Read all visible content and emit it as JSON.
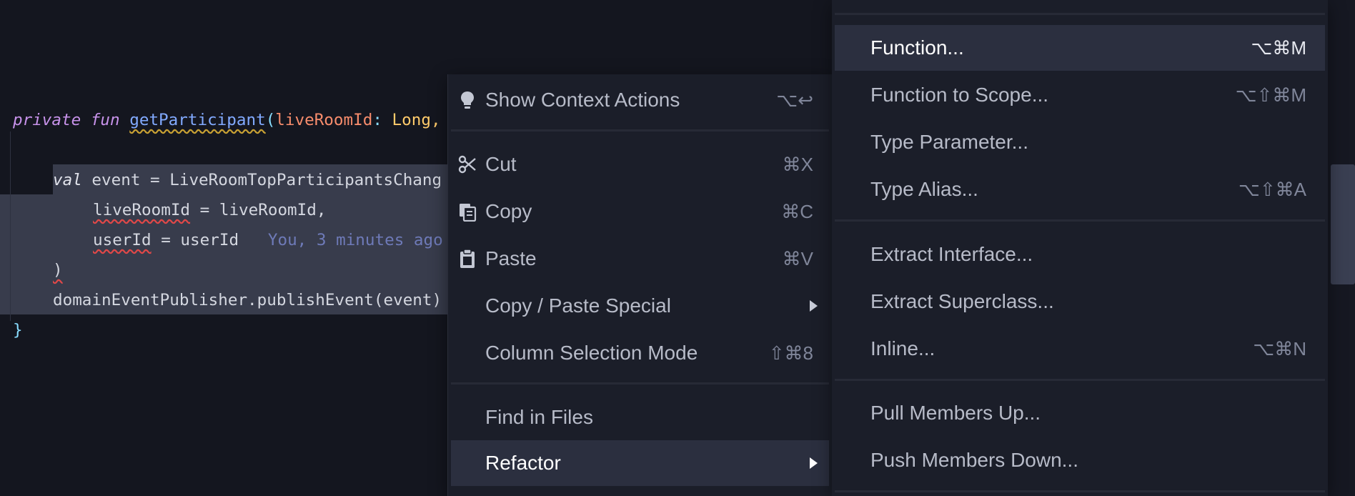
{
  "editor": {
    "line1": {
      "kw_private": "private",
      "kw_fun": "fun",
      "fn_name": "getParticipant",
      "open_paren": "(",
      "param": "liveRoomId",
      "colon": ":",
      "type": "Long,"
    },
    "line3": {
      "kw_val": "val",
      "rest": " event = LiveRoomTopParticipantsChang"
    },
    "line4": {
      "arg": "liveRoomId",
      "rest": " = liveRoomId,"
    },
    "line5": {
      "arg": "userId",
      "rest": " = userId",
      "blame": "You, 3 minutes ago"
    },
    "line6": {
      "text": ")"
    },
    "line7": {
      "text": "domainEventPublisher.publishEvent(event)"
    },
    "line8": {
      "text": "}"
    }
  },
  "context_menu": {
    "items": [
      {
        "label": "Show Context Actions",
        "shortcut": "⌥↩",
        "icon": "lightbulb-icon"
      },
      {
        "label": "Cut",
        "shortcut": "⌘X",
        "icon": "scissors-icon"
      },
      {
        "label": "Copy",
        "shortcut": "⌘C",
        "icon": "copy-icon"
      },
      {
        "label": "Paste",
        "shortcut": "⌘V",
        "icon": "clipboard-icon"
      },
      {
        "label": "Copy / Paste Special",
        "shortcut": ""
      },
      {
        "label": "Column Selection Mode",
        "shortcut": "⇧⌘8"
      },
      {
        "label": "Find in Files",
        "shortcut": ""
      },
      {
        "label": "Refactor",
        "shortcut": ""
      }
    ]
  },
  "refactor_submenu": {
    "items": [
      {
        "label": "Function...",
        "shortcut": "⌥⌘M"
      },
      {
        "label": "Function to Scope...",
        "shortcut": "⌥⇧⌘M"
      },
      {
        "label": "Type Parameter...",
        "shortcut": ""
      },
      {
        "label": "Type Alias...",
        "shortcut": "⌥⇧⌘A"
      },
      {
        "label": "Extract Interface...",
        "shortcut": ""
      },
      {
        "label": "Extract Superclass...",
        "shortcut": ""
      },
      {
        "label": "Inline...",
        "shortcut": "⌥⌘N"
      },
      {
        "label": "Pull Members Up...",
        "shortcut": ""
      },
      {
        "label": "Push Members Down...",
        "shortcut": ""
      }
    ]
  }
}
